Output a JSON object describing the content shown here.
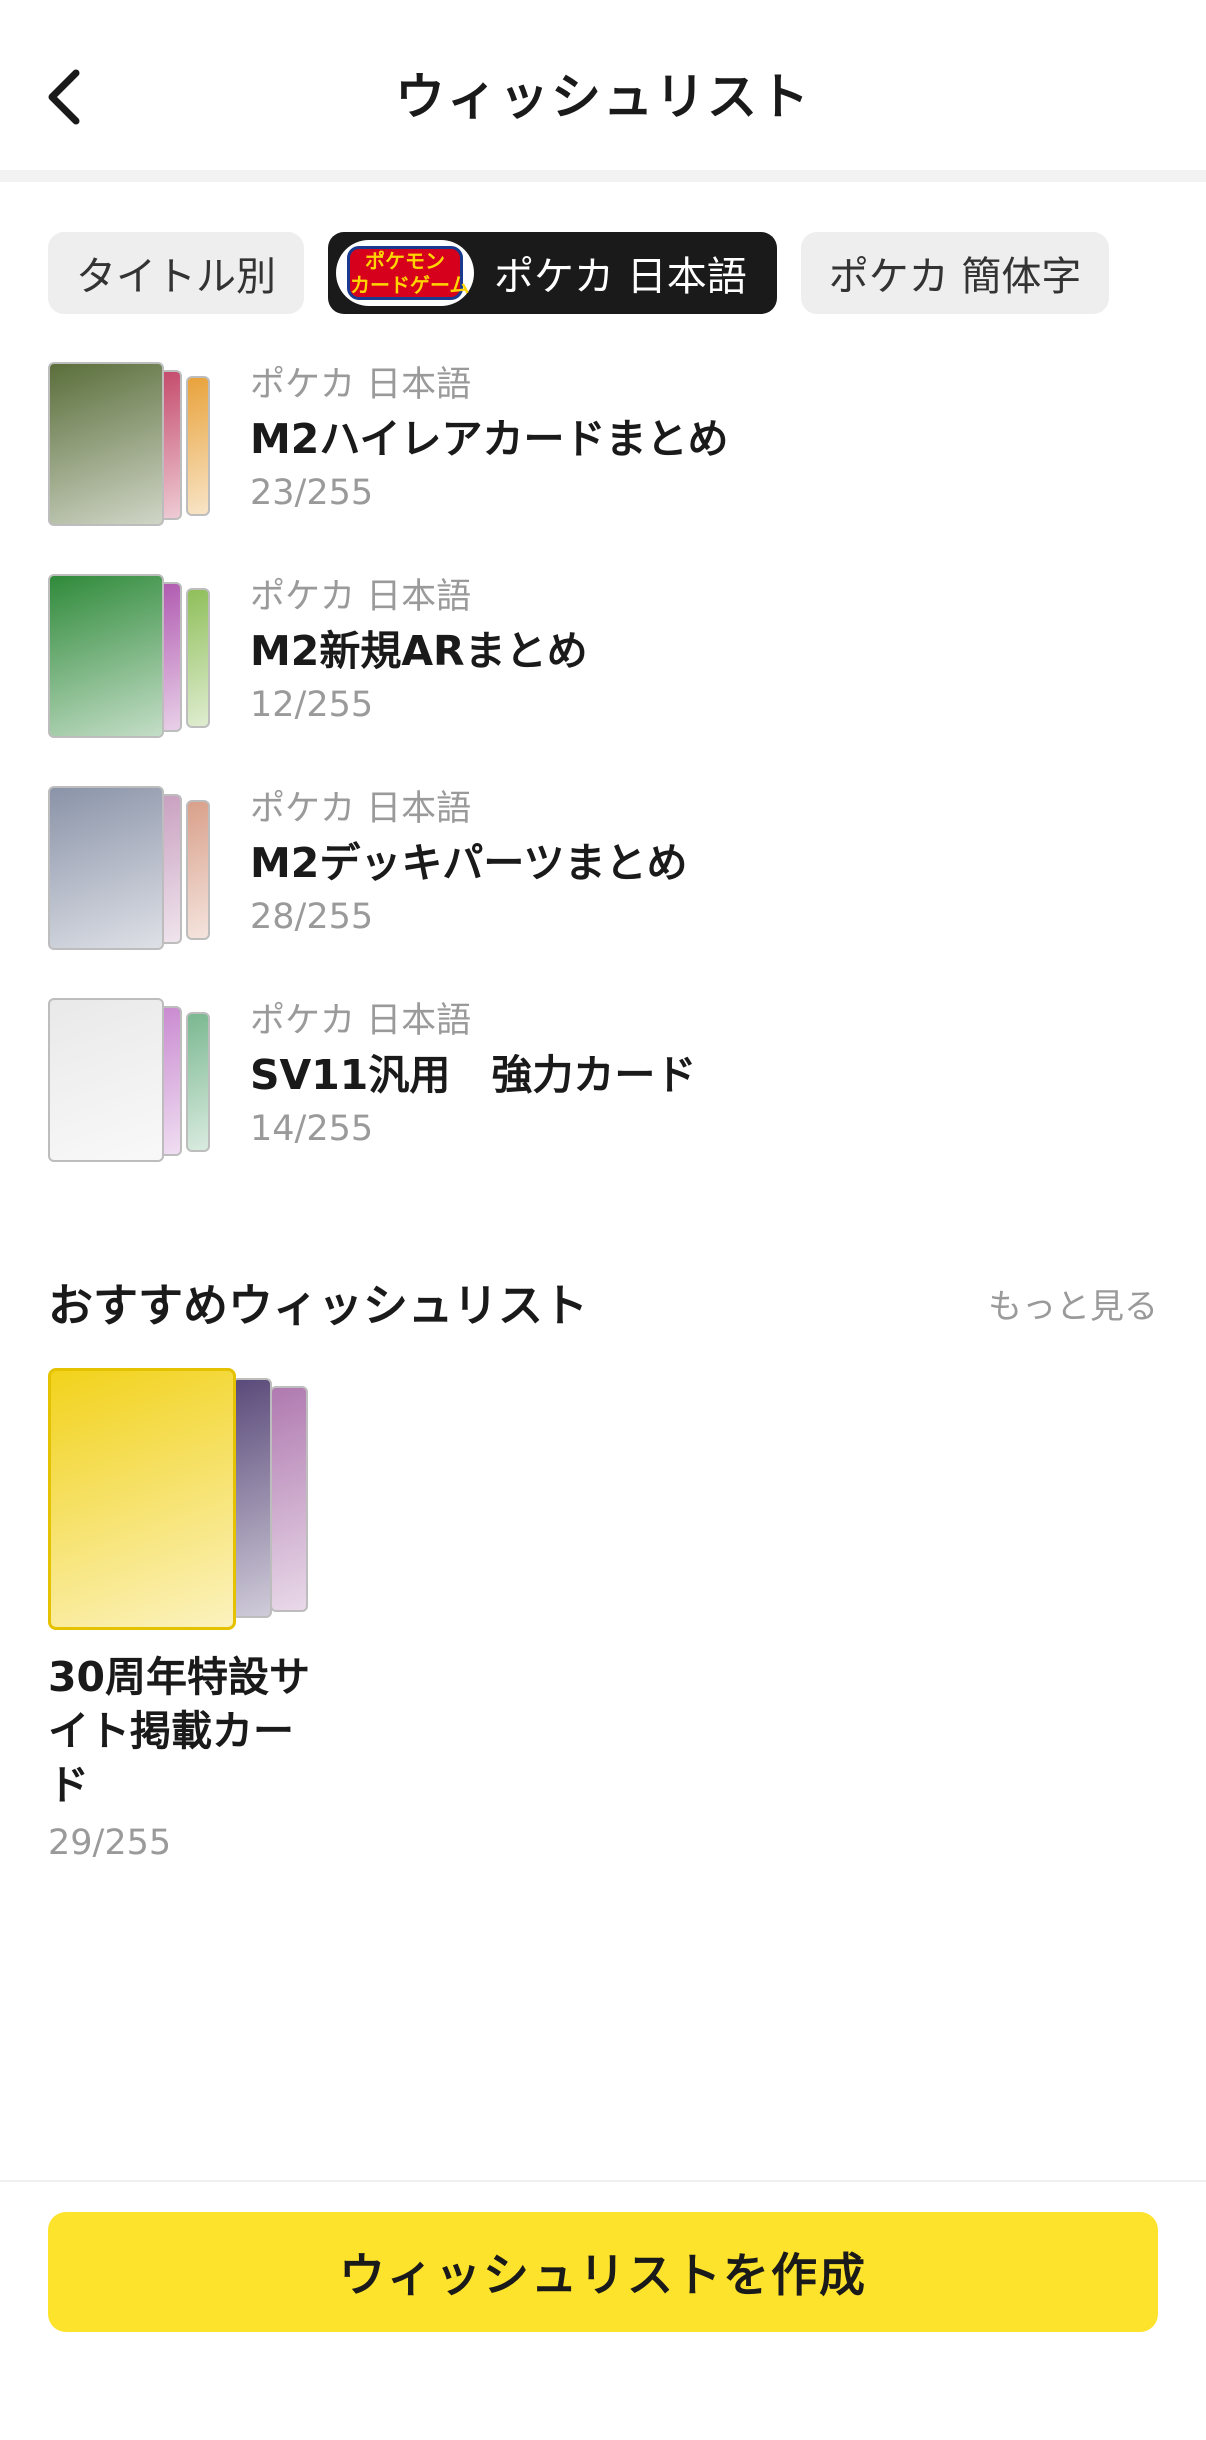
{
  "header": {
    "title": "ウィッシュリスト",
    "back_icon": "chevron-left-icon"
  },
  "filters": [
    {
      "label": "タイトル別",
      "active": false
    },
    {
      "label": "ポケカ 日本語",
      "active": true,
      "logo_text": [
        "ポケモン",
        "カードゲーム"
      ]
    },
    {
      "label": "ポケカ 簡体字",
      "active": false
    }
  ],
  "wishlists": [
    {
      "category": "ポケカ 日本語",
      "name": "M2ハイレアカードまとめ",
      "count": "23/255",
      "colors": [
        "#5a6e3a",
        "#c44a6b",
        "#e8a23a"
      ]
    },
    {
      "category": "ポケカ 日本語",
      "name": "M2新規ARまとめ",
      "count": "12/255",
      "colors": [
        "#2f8a3a",
        "#b05ab0",
        "#8fbf5a"
      ]
    },
    {
      "category": "ポケカ 日本語",
      "name": "M2デッキパーツまとめ",
      "count": "28/255",
      "colors": [
        "#8a93a8",
        "#c9a0c0",
        "#d9a08a"
      ]
    },
    {
      "category": "ポケカ 日本語",
      "name": "SV11汎用　強力カード",
      "count": "14/255",
      "colors": [
        "#e9e9e9",
        "#c98ad0",
        "#7ab890"
      ]
    }
  ],
  "recommended": {
    "title": "おすすめウィッシュリスト",
    "see_more": "もっと見る",
    "items": [
      {
        "name": "30周年特設サイト掲載カード",
        "count": "29/255",
        "colors": [
          "#f2d21b",
          "#5a4a7a",
          "#b07ab0"
        ]
      }
    ]
  },
  "create_button": {
    "label": "ウィッシュリストを作成",
    "color": "#fde32c"
  }
}
